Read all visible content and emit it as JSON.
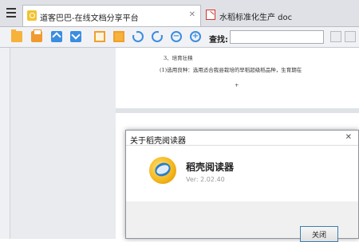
{
  "tabs": [
    {
      "title": "道客巴巴-在线文档分享平台",
      "icon": "docin-logo-icon",
      "active": true
    },
    {
      "title": "水稻标准化生产 doc",
      "icon": "pdf-file-icon",
      "active": false
    }
  ],
  "tab_close_glyph": "✕",
  "toolbar": {
    "find_label": "查找:",
    "find_value": "",
    "zoom_out_glyph": "−",
    "zoom_in_glyph": "+"
  },
  "document": {
    "lines": [
      "3、培育壮秧",
      "(1)选用良种：选用适合我县栽培的早稻超级稻品种，生育期在",
      "+"
    ]
  },
  "dialog": {
    "title": "关于稻壳阅读器",
    "close_glyph": "✕",
    "app_name": "稻壳阅读器",
    "version": "Ver: 2.02.40",
    "close_button": "关闭"
  },
  "colors": {
    "tab_bar": "#dfe1e6",
    "toolbar": "#f1f2f5",
    "icon_blue": "#3b8de0",
    "icon_orange": "#f6b23b",
    "pdf_red": "#d7322a"
  }
}
